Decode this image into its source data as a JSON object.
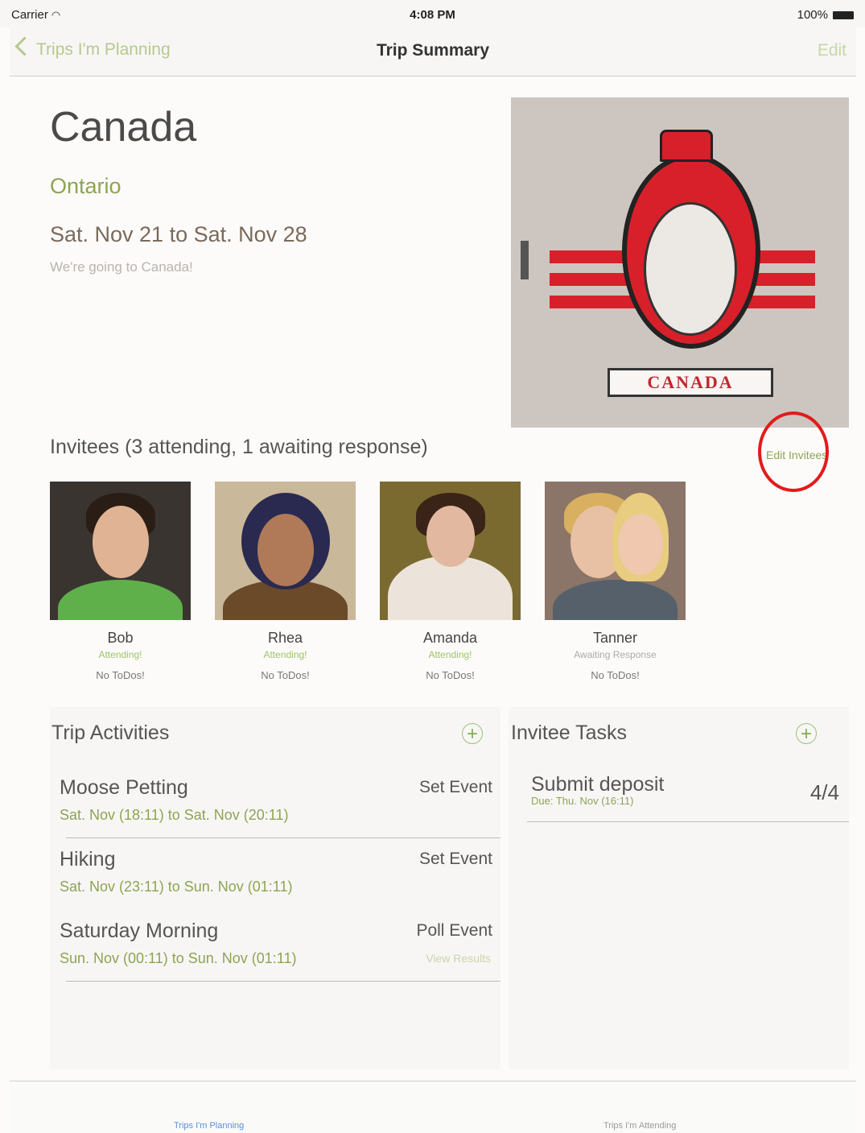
{
  "status_bar": {
    "carrier": "Carrier",
    "time": "4:08 PM",
    "battery": "100%"
  },
  "nav": {
    "back_label": "Trips I'm Planning",
    "title": "Trip Summary",
    "edit_label": "Edit"
  },
  "trip": {
    "name": "Canada",
    "region": "Ontario",
    "dates": "Sat. Nov 21 to Sat. Nov 28",
    "description": "We're going to Canada!",
    "image_banner": "CANADA"
  },
  "invitees": {
    "header": "Invitees (3 attending, 1 awaiting response)",
    "edit_label": "Edit Invitees",
    "people": [
      {
        "name": "Bob",
        "status": "Attending!",
        "todos": "No ToDos!"
      },
      {
        "name": "Rhea",
        "status": "Attending!",
        "todos": "No ToDos!"
      },
      {
        "name": "Amanda",
        "status": "Attending!",
        "todos": "No ToDos!"
      },
      {
        "name": "Tanner",
        "status": "Awaiting Response",
        "todos": "No ToDos!"
      }
    ]
  },
  "activities": {
    "title": "Trip Activities",
    "add_symbol": "+",
    "items": [
      {
        "name": "Moose Petting",
        "time": "Sat. Nov (18:11) to Sat. Nov (20:11)",
        "action": "Set Event",
        "sub": ""
      },
      {
        "name": "Hiking",
        "time": "Sat. Nov (23:11) to Sun. Nov (01:11)",
        "action": "Set Event",
        "sub": ""
      },
      {
        "name": "Saturday Morning",
        "time": "Sun. Nov (00:11) to Sun. Nov (01:11)",
        "action": "Poll Event",
        "sub": "View Results"
      }
    ]
  },
  "tasks": {
    "title": "Invitee Tasks",
    "add_symbol": "+",
    "items": [
      {
        "name": "Submit deposit",
        "due": "Due: Thu. Nov (16:11)",
        "count": "4/4"
      }
    ]
  },
  "tabs": {
    "planning": "Trips I'm Planning",
    "attending": "Trips I'm Attending"
  },
  "colors": {
    "accent_green": "#8ba552",
    "highlight_red": "#e21b1b",
    "tab_active": "#5a8fd8"
  }
}
